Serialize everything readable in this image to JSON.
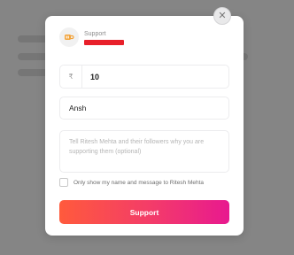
{
  "modal": {
    "close_icon": "close-icon",
    "header": {
      "icon": "coffee-cup-icon",
      "support_label": "Support",
      "creator_name_redacted": true
    },
    "amount": {
      "currency_symbol": "₹",
      "value": "10"
    },
    "name": {
      "value": "Ansh"
    },
    "message": {
      "placeholder": "Tell Ritesh Mehta and their followers why you are supporting them (optional)"
    },
    "privacy_checkbox": {
      "checked": false,
      "label": "Only show my name and message to Ritesh Mehta"
    },
    "submit": {
      "label": "Support"
    },
    "colors": {
      "button_gradient_start": "#ff5a3c",
      "button_gradient_end": "#e8198f",
      "redaction": "#e8202a"
    }
  }
}
